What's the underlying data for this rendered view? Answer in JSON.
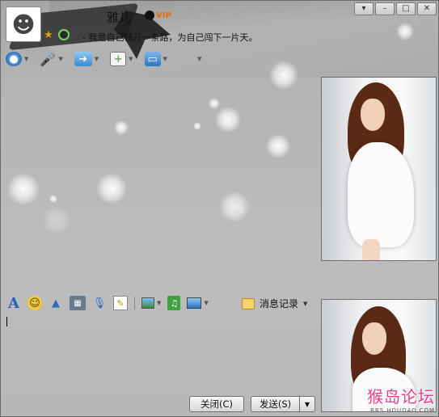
{
  "contact": {
    "nickname": "雅儿",
    "vip_label": "VIP",
    "signature": "- 我是自己铺开一条路，为自己闯下一片天。",
    "avatar_icon": "person-cartoon-icon",
    "status": "online"
  },
  "window_controls": {
    "menu": "▾",
    "minimize": "–",
    "maximize": "□",
    "close": "✕"
  },
  "toolbar": {
    "items": [
      {
        "icon": "video-camera-icon",
        "color": "#2f6db5"
      },
      {
        "icon": "microphone-icon",
        "color": "#3d7fcf"
      },
      {
        "icon": "send-file-icon",
        "color": "#3b8ad0"
      },
      {
        "icon": "create-discussion-icon",
        "color": "#3a9a4a"
      },
      {
        "icon": "remote-assist-icon",
        "color": "#2e74c2"
      },
      {
        "icon": "apps-icon",
        "color": "#e04a3a"
      }
    ]
  },
  "format_bar": {
    "font_icon": "A",
    "emoji_icon": "☺",
    "history_label": "消息记录"
  },
  "buttons": {
    "close_label": "关闭(C)",
    "send_label": "发送(S)",
    "send_arrow": "▼"
  },
  "watermark": {
    "main": "猴岛论坛",
    "sub": "BBS.HOUDAO.COM"
  }
}
